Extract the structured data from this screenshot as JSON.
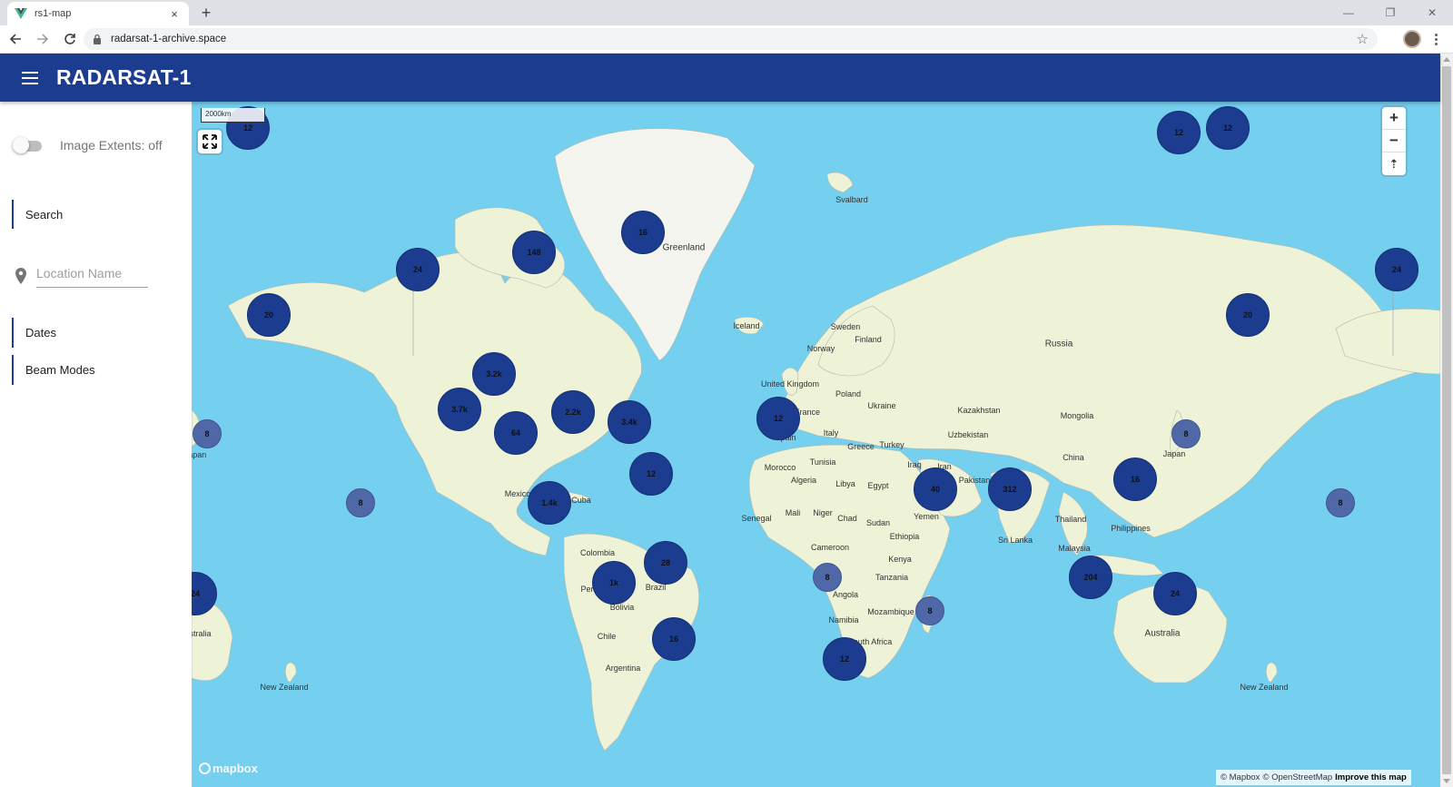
{
  "browser": {
    "tab_title": "rs1-map",
    "new_tab": "+",
    "tab_close": "×",
    "url": "radarsat-1-archive.space",
    "win_minimize": "—",
    "win_restore": "❐",
    "win_close": "✕",
    "bookmark_star": "☆"
  },
  "app": {
    "title": "RADARSAT-1",
    "header_color": "#1b3c8f"
  },
  "sidebar": {
    "image_extents_label": "Image Extents: off",
    "image_extents_on": false,
    "search_label": "Search",
    "location_placeholder": "Location Name",
    "dates_label": "Dates",
    "beam_modes_label": "Beam Modes"
  },
  "map": {
    "scale_label": "2000km",
    "zoom_in": "+",
    "zoom_out": "−",
    "compass": "⇡",
    "mapbox_logo": "mapbox",
    "attribution": {
      "mapbox": "© Mapbox",
      "osm": "© OpenStreetMap",
      "improve": "Improve this map"
    },
    "clusters": [
      {
        "label": "12"
      },
      {
        "label": "12"
      },
      {
        "label": "12"
      },
      {
        "label": "16"
      },
      {
        "label": "148"
      },
      {
        "label": "24"
      },
      {
        "label": "20"
      },
      {
        "label": "24"
      },
      {
        "label": "20"
      },
      {
        "label": "8"
      },
      {
        "label": "3.2k"
      },
      {
        "label": "3.7k"
      },
      {
        "label": "2.2k"
      },
      {
        "label": "3.4k"
      },
      {
        "label": "64"
      },
      {
        "label": "12"
      },
      {
        "label": "8"
      },
      {
        "label": "12"
      },
      {
        "label": "1.4k"
      },
      {
        "label": "28"
      },
      {
        "label": "1k"
      },
      {
        "label": "16"
      },
      {
        "label": "24"
      },
      {
        "label": "40"
      },
      {
        "label": "312"
      },
      {
        "label": "8"
      },
      {
        "label": "16"
      },
      {
        "label": "8"
      },
      {
        "label": "8"
      },
      {
        "label": "8"
      },
      {
        "label": "204"
      },
      {
        "label": "24"
      },
      {
        "label": "12"
      }
    ],
    "places": [
      "Greenland",
      "Svalbard",
      "Iceland",
      "Sweden",
      "Finland",
      "Norway",
      "United Kingdom",
      "Poland",
      "Ukraine",
      "France",
      "Spain",
      "Italy",
      "Greece",
      "Turkey",
      "Russia",
      "Kazakhstan",
      "Mongolia",
      "Uzbekistan",
      "Iraq",
      "Iran",
      "Pakistan",
      "China",
      "Japan",
      "Tunisia",
      "Morocco",
      "Algeria",
      "Libya",
      "Egypt",
      "Mali",
      "Niger",
      "Chad",
      "Sudan",
      "Senegal",
      "Ethiopia",
      "Yemen",
      "Cameroon",
      "Kenya",
      "Tanzania",
      "Angola",
      "Mozambique",
      "Namibia",
      "South Africa",
      "Thailand",
      "Philippines",
      "Sri Lanka",
      "Malaysia",
      "Australia",
      "New Zealand",
      "New Zealand",
      "Mexico",
      "Cuba",
      "Colombia",
      "Peru",
      "Brazil",
      "Bolivia",
      "Chile",
      "Argentina",
      "Japan",
      "Australia"
    ],
    "colors": {
      "water": "#75cfef",
      "land": "#eef2d6",
      "ice": "#f5f5f0",
      "cluster_large": "#1b3c8f",
      "cluster_small": "#5068a8"
    }
  }
}
